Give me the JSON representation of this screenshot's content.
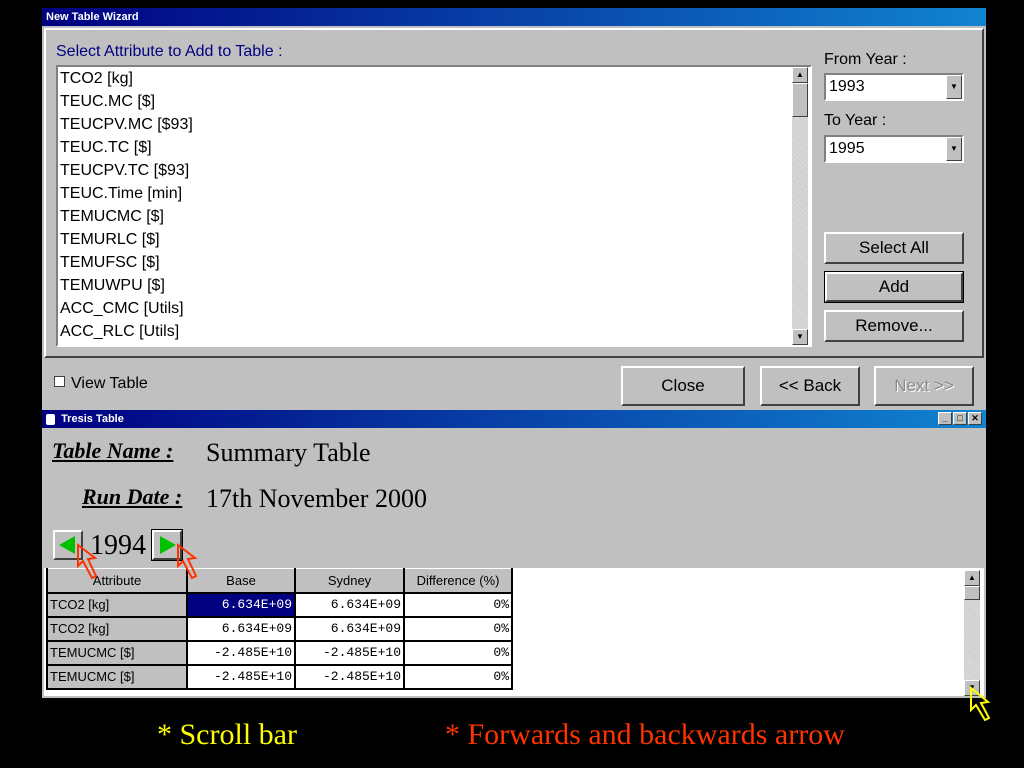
{
  "wizard": {
    "title": "New Table Wizard",
    "select_label": "Select Attribute to Add to Table :",
    "attributes": [
      "TCO2 [kg]",
      "TEUC.MC [$]",
      "TEUCPV.MC [$93]",
      "TEUC.TC [$]",
      "TEUCPV.TC [$93]",
      "TEUC.Time [min]",
      "TEMUCMC [$]",
      "TEMURLC [$]",
      "TEMUFSC [$]",
      "TEMUWPU [$]",
      "ACC_CMC [Utils]",
      "ACC_RLC [Utils]"
    ],
    "from_year_label": "From Year :",
    "from_year_value": "1993",
    "to_year_label": "To Year :",
    "to_year_value": "1995",
    "select_all_label": "Select All",
    "add_label": "Add",
    "remove_label": "Remove...",
    "view_table_label": "View Table",
    "close_label": "Close",
    "back_label": "<< Back",
    "next_label": "Next >>"
  },
  "tresis": {
    "title": "Tresis Table",
    "table_name_label": "Table Name :",
    "table_name_value": "Summary Table",
    "run_date_label": "Run Date :",
    "run_date_value": "17th November 2000",
    "year": "1994",
    "columns": [
      "Attribute",
      "Base",
      "Sydney",
      "Difference (%)"
    ],
    "rows": [
      {
        "attribute": "TCO2 [kg]",
        "base": "6.634E+09",
        "sydney": "6.634E+09",
        "diff": "0%"
      },
      {
        "attribute": "TCO2 [kg]",
        "base": "6.634E+09",
        "sydney": "6.634E+09",
        "diff": "0%"
      },
      {
        "attribute": "TEMUCMC [$]",
        "base": "-2.485E+10",
        "sydney": "-2.485E+10",
        "diff": "0%"
      },
      {
        "attribute": "TEMUCMC [$]",
        "base": "-2.485E+10",
        "sydney": "-2.485E+10",
        "diff": "0%"
      }
    ]
  },
  "annotations": {
    "scroll_bar": "* Scroll bar",
    "arrows": "* Forwards and backwards arrow"
  },
  "colors": {
    "annotation_yellow": "#ffff00",
    "annotation_red": "#ff3300",
    "title_blue": "#000080",
    "nav_arrow_green": "#00c000"
  }
}
